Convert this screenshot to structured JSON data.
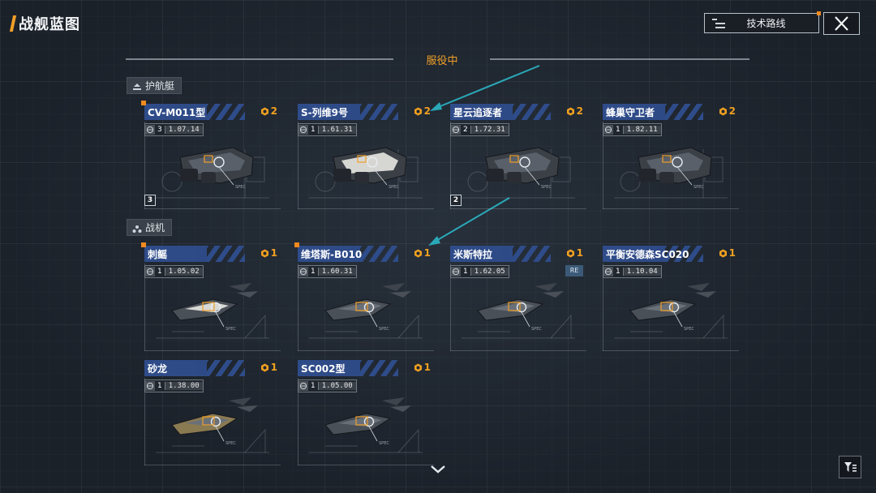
{
  "header": {
    "title": "战舰蓝图",
    "tech_route_label": "技术路线"
  },
  "section": {
    "title": "服役中"
  },
  "categories": [
    {
      "label": "护航艇",
      "icon": "escort-icon"
    },
    {
      "label": "战机",
      "icon": "fighter-icon"
    }
  ],
  "cards": [
    {
      "name": "CV-M011型",
      "rank": "2",
      "count": "3",
      "level": "3",
      "version": "1.07.14",
      "new": true,
      "kind": "escort"
    },
    {
      "name": "S-列维9号",
      "rank": "2",
      "count": "",
      "level": "1",
      "version": "1.61.31",
      "new": false,
      "kind": "escort"
    },
    {
      "name": "星云追逐者",
      "rank": "2",
      "count": "2",
      "level": "2",
      "version": "1.72.31",
      "new": false,
      "kind": "escort"
    },
    {
      "name": "蜂巢守卫者",
      "rank": "2",
      "count": "",
      "level": "1",
      "version": "1.82.11",
      "new": false,
      "kind": "escort"
    },
    {
      "name": "刺鳐",
      "rank": "1",
      "count": "",
      "level": "1",
      "version": "1.05.02",
      "new": true,
      "kind": "fighter"
    },
    {
      "name": "维塔斯-B010",
      "rank": "1",
      "count": "",
      "level": "1",
      "version": "1.60.31",
      "new": true,
      "kind": "fighter"
    },
    {
      "name": "米斯特拉",
      "rank": "1",
      "count": "",
      "level": "1",
      "version": "1.62.05",
      "new": false,
      "kind": "fighter",
      "tag": "RE"
    },
    {
      "name": "平衡安德森SC020",
      "rank": "1",
      "count": "",
      "level": "1",
      "version": "1.10.04",
      "new": false,
      "kind": "fighter"
    },
    {
      "name": "砂龙",
      "rank": "1",
      "count": "",
      "level": "1",
      "version": "1.38.00",
      "new": false,
      "kind": "fighter"
    },
    {
      "name": "SC002型",
      "rank": "1",
      "count": "",
      "level": "1",
      "version": "1.05.00",
      "new": false,
      "kind": "fighter"
    }
  ],
  "colors": {
    "accent": "#f0a028",
    "name_bar": "#2f4c8a",
    "arrow": "#2aa8b8",
    "new_dot": "#f08a20"
  }
}
